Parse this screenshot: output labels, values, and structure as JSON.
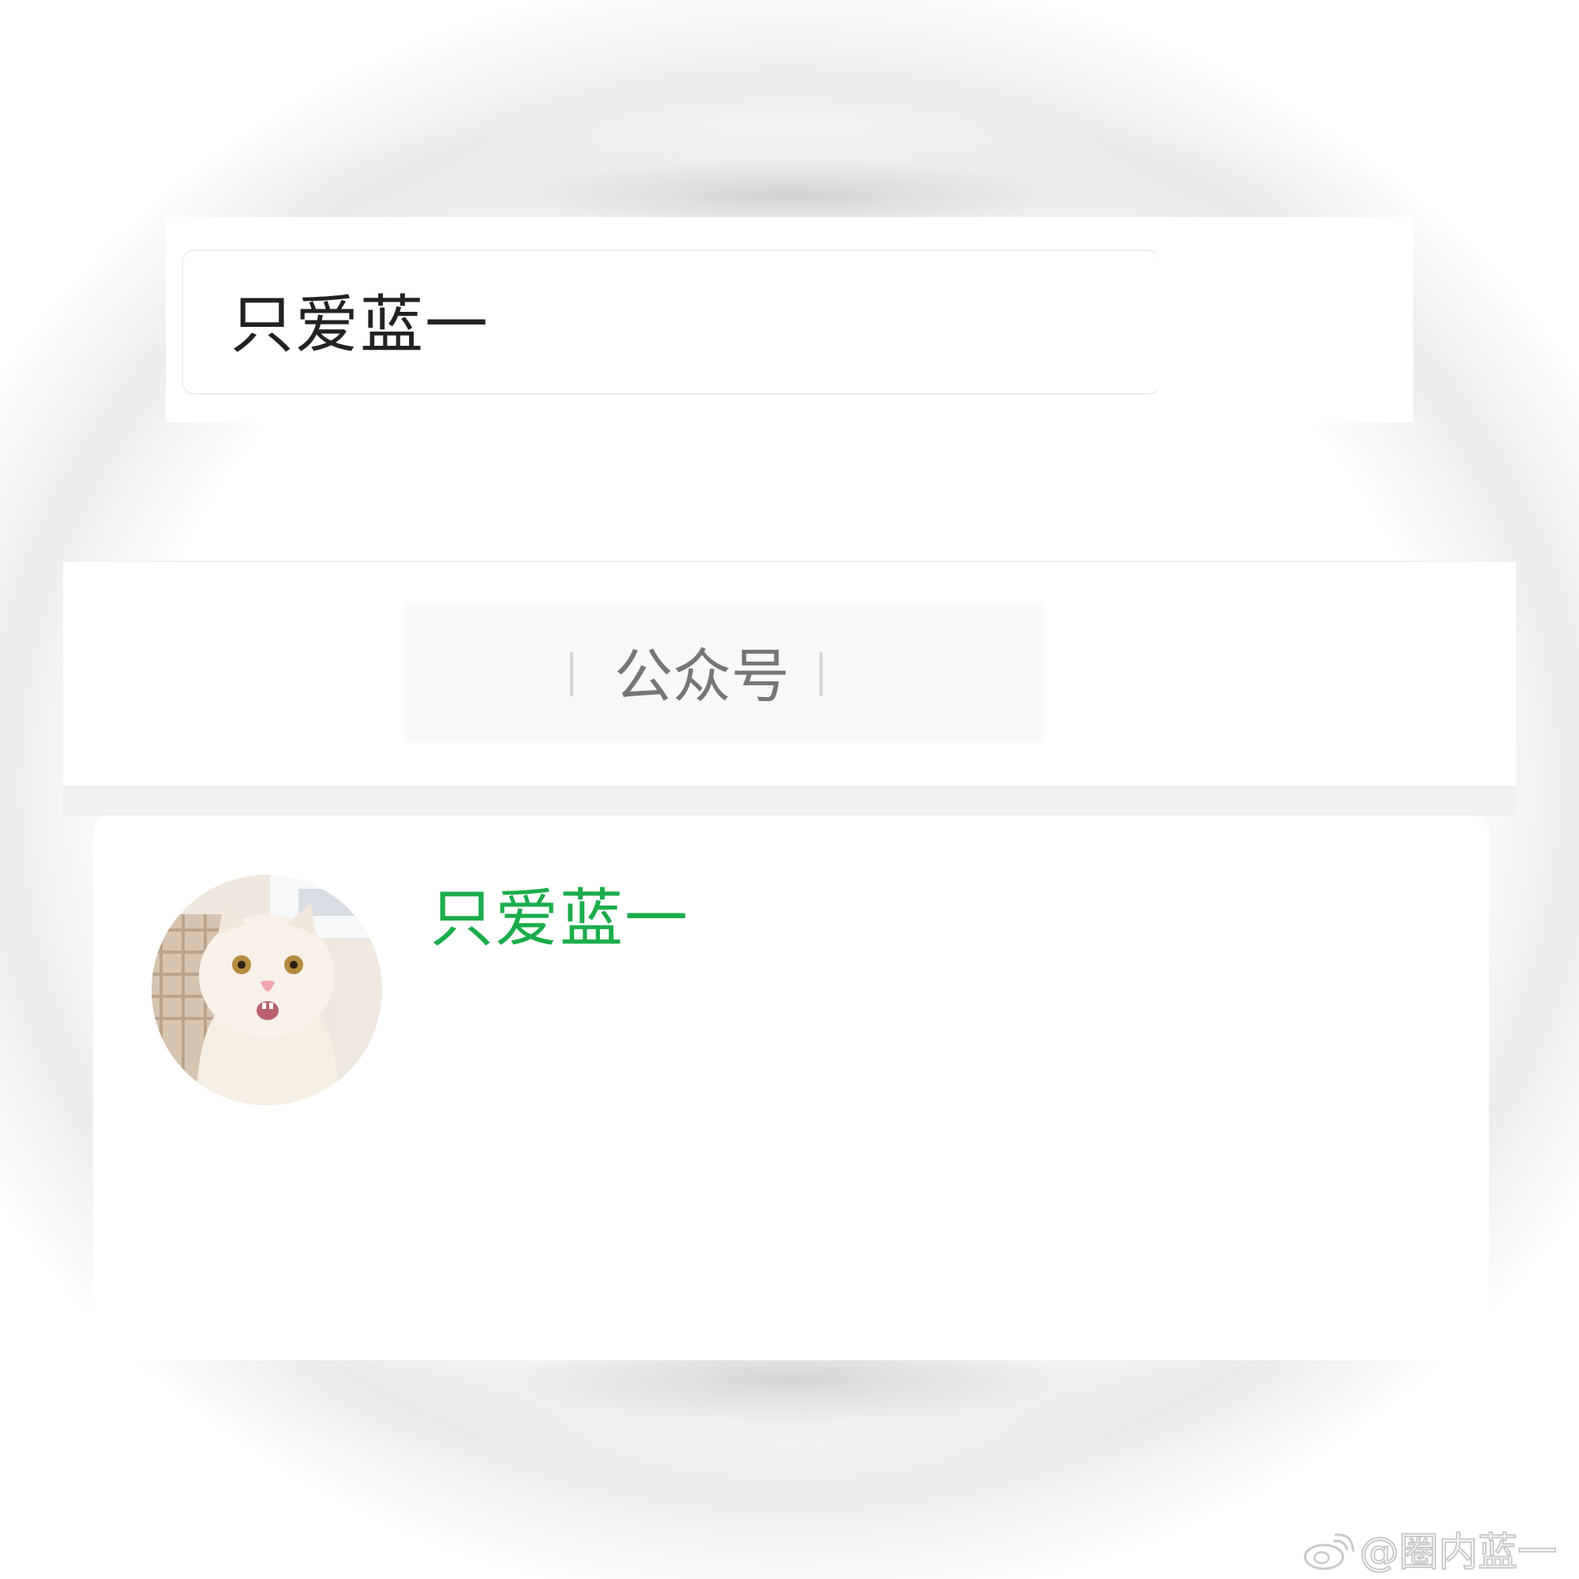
{
  "search": {
    "query": "只爱蓝一"
  },
  "tabs": {
    "active_label": "公众号"
  },
  "result": {
    "account_name": "只爱蓝一",
    "avatar_icon": "cat-avatar-icon"
  },
  "watermark": {
    "text": "@圈内蓝一",
    "logo_icon": "weibo-logo-icon"
  },
  "colors": {
    "accent_green": "#1aad4b",
    "tab_text": "#767676",
    "search_text": "#222222"
  }
}
